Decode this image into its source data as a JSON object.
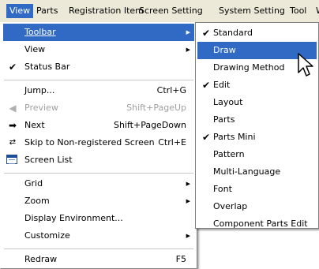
{
  "menubar": {
    "items": [
      "View",
      "Parts",
      "Registration Item",
      "Screen Setting",
      "System Setting",
      "Tool",
      "W"
    ]
  },
  "view_menu": {
    "items": [
      {
        "label": "Toolbar",
        "accel": "T",
        "submenu": true,
        "highlighted": true
      },
      {
        "label": "View",
        "accel": "V",
        "submenu": true
      },
      {
        "label": "Status Bar",
        "accel": "S",
        "checked": true
      },
      {
        "label": "Jump...",
        "accel": "J",
        "shortcut": "Ctrl+G"
      },
      {
        "label": "Preview",
        "accel": "P",
        "shortcut": "Shift+PageUp",
        "disabled": true,
        "icon": "arrow-left-icon"
      },
      {
        "label": "Next",
        "accel": "N",
        "shortcut": "Shift+PageDown",
        "icon": "arrow-right-icon"
      },
      {
        "label": "Skip to Non-registered Screen",
        "accel": "k",
        "shortcut": "Ctrl+E",
        "icon": "skip-icon"
      },
      {
        "label": "Screen List",
        "accel": "L",
        "icon": "screen-list-icon"
      },
      {
        "label": "Grid",
        "accel": "G",
        "submenu": true
      },
      {
        "label": "Zoom",
        "accel": "Z",
        "submenu": true
      },
      {
        "label": "Display Environment...",
        "accel": ""
      },
      {
        "label": "Customize",
        "accel": "C",
        "submenu": true
      },
      {
        "label": "Redraw",
        "accel": "R",
        "shortcut": "F5"
      }
    ]
  },
  "toolbar_submenu": {
    "items": [
      {
        "label": "Standard",
        "checked": true
      },
      {
        "label": "Draw",
        "highlighted": true
      },
      {
        "label": "Drawing Method"
      },
      {
        "label": "Edit",
        "checked": true
      },
      {
        "label": "Layout"
      },
      {
        "label": "Parts"
      },
      {
        "label": "Parts Mini",
        "checked": true
      },
      {
        "label": "Pattern"
      },
      {
        "label": "Multi-Language"
      },
      {
        "label": "Font"
      },
      {
        "label": "Overlap"
      },
      {
        "label": "Component Parts Edit"
      }
    ]
  },
  "colors": {
    "menubar_bg": "#ece9d8",
    "highlight": "#316ac5",
    "disabled": "#a0a0a0"
  }
}
